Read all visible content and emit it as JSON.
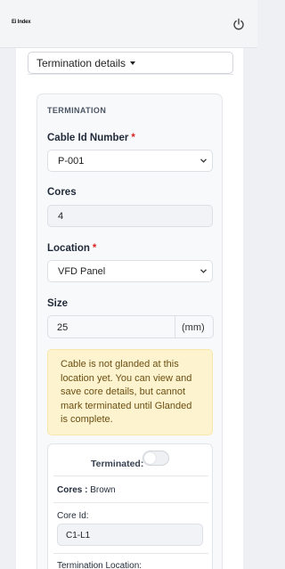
{
  "header": {
    "logo_text": "Ei Index",
    "power_icon": "power-icon"
  },
  "section_menu": {
    "label": "Termination details"
  },
  "termination": {
    "section_title": "TERMINATION",
    "cable_id": {
      "label": "Cable Id Number",
      "required_mark": "*",
      "value": "P-001"
    },
    "cores": {
      "label": "Cores",
      "value": "4"
    },
    "location": {
      "label": "Location",
      "required_mark": "*",
      "value": "VFD Panel"
    },
    "size": {
      "label": "Size",
      "value": "25",
      "unit": "(mm)"
    },
    "alert_text": "Cable is not glanded at this location yet. You can view and save core details, but cannot mark terminated until Glanded is complete.",
    "core_card": {
      "terminated_label": "Terminated:",
      "terminated_on": false,
      "cores_label": "Cores :",
      "cores_value": "Brown",
      "core_id_label": "Core Id:",
      "core_id_value": "C1-L1",
      "termination_location_label": "Termination Location:"
    }
  },
  "colors": {
    "required": "#dc2626",
    "alert_bg": "#fdf3cf",
    "alert_text": "#6b4f12"
  }
}
